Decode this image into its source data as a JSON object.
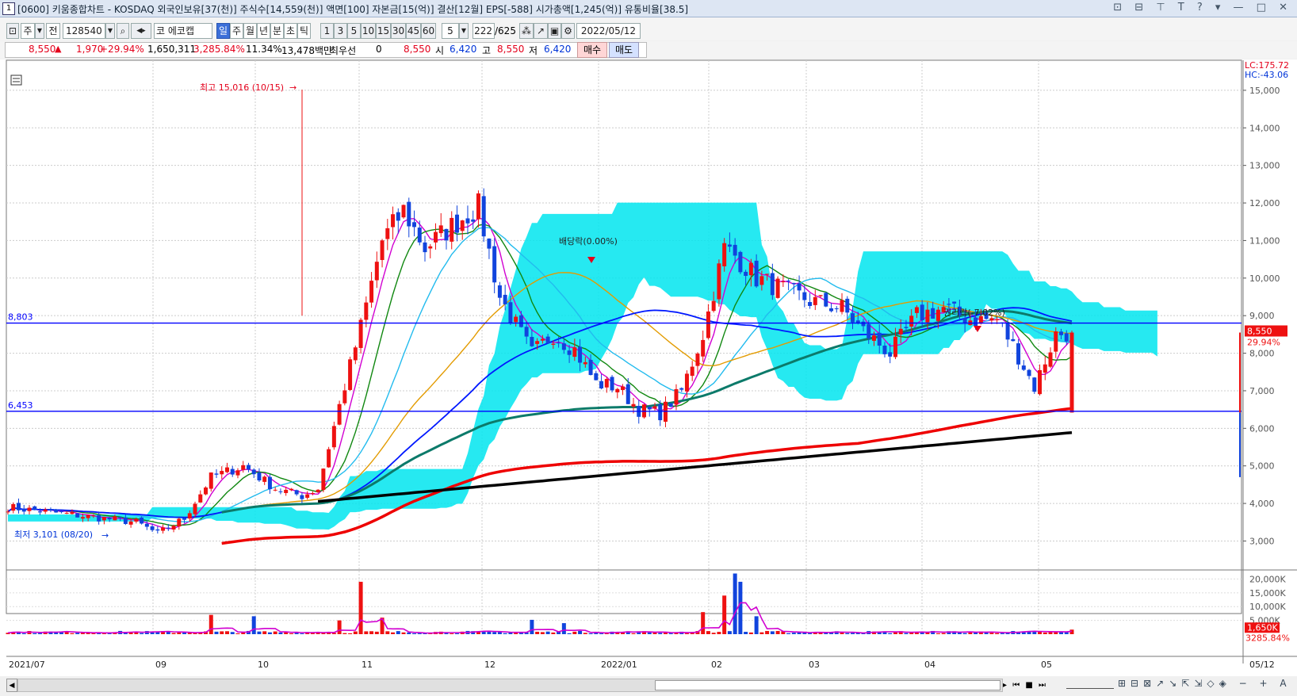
{
  "window": {
    "number": "1",
    "title": "[0600] 키움종합차트 - KOSDAQ 외국인보유[37(천)] 주식수[14,559(천)] 액면[100] 자본금[15(억)] 결산[12월] EPS[-588] 시가총액[1,245(억)] 유통비율[38.5]",
    "icons": "⊡ ⊟ ⊤ T ? ▾ — □ ✕"
  },
  "toolbar": {
    "period_week": "주",
    "prev": "전",
    "code": "128540",
    "name": "에코캡",
    "market_mark": "코",
    "tabs": [
      "일",
      "주",
      "월",
      "년",
      "분",
      "초",
      "틱"
    ],
    "active_tab": "일",
    "minute_options": [
      "1",
      "3",
      "5",
      "10",
      "15",
      "30",
      "45",
      "60"
    ],
    "count_value": "5",
    "range": "222",
    "range_total": "/625",
    "date": "2022/05/12"
  },
  "quote": {
    "price": "8,550",
    "change": "1,970",
    "change_rate": "+29.94%",
    "volume": "1,650,311",
    "volume_rate": "3,285.84%",
    "turnover": "11.34%",
    "amount": "13,478백만",
    "pref_label": "최우선",
    "pref_value": "0",
    "bid": "8,550",
    "open_label": "시",
    "open": "6,420",
    "high_label": "고",
    "high": "8,550",
    "low_label": "저",
    "low": "6,420",
    "buy_label": "매수",
    "sell_label": "매도"
  },
  "chart_data": {
    "type": "candlestick",
    "period": "daily",
    "start": "2021/07",
    "end": "2022/05/12",
    "x_tick_labels": [
      "2021/07",
      "09",
      "10",
      "11",
      "12",
      "2022/01",
      "02",
      "03",
      "04",
      "05",
      "05/12"
    ],
    "y_tick_labels": [
      "15,000",
      "14,000",
      "13,000",
      "12,000",
      "11,000",
      "10,000",
      "9,000",
      "8,000",
      "7,000",
      "6,000",
      "5,000",
      "4,000",
      "3,000"
    ],
    "ylim": [
      2250,
      15800
    ],
    "volume_tick_labels": [
      "20,000K",
      "15,000K",
      "10,000K",
      "5,000K"
    ],
    "volume_ylim": [
      0,
      23000
    ],
    "corner_labels": {
      "lc": "LC:175.72",
      "hc": "HC:-43.06"
    },
    "horizontal_lines": [
      {
        "value": 8803,
        "label": "8,803",
        "color": "#0000ff"
      },
      {
        "value": 6453,
        "label": "6,453",
        "color": "#0000ff"
      }
    ],
    "annotations": {
      "high": "최고 15,016 (10/15)",
      "low": "최저 3,101 (08/20)",
      "dividend": "배당락(0.00%)",
      "rights": "권리락(-7.02%)"
    },
    "last_price_tag": "8,550",
    "last_change_tag": "29.94%",
    "volume_last_tag": "1,650K",
    "volume_rate_tag": "3285.84%",
    "moving_averages": [
      {
        "period": 5,
        "color": "#d100d1"
      },
      {
        "period": 10,
        "color": "#118811"
      },
      {
        "period": 20,
        "color": "#22bbee"
      },
      {
        "period": 40,
        "color": "#e39b00"
      },
      {
        "period": 60,
        "color": "#0018ff"
      },
      {
        "period": 120,
        "color": "#0c7a6a"
      },
      {
        "period": 240,
        "color": "#ee0000"
      },
      {
        "period": 480,
        "color": "#000000"
      }
    ],
    "ichimoku_cloud_color": "#00e5ee"
  }
}
